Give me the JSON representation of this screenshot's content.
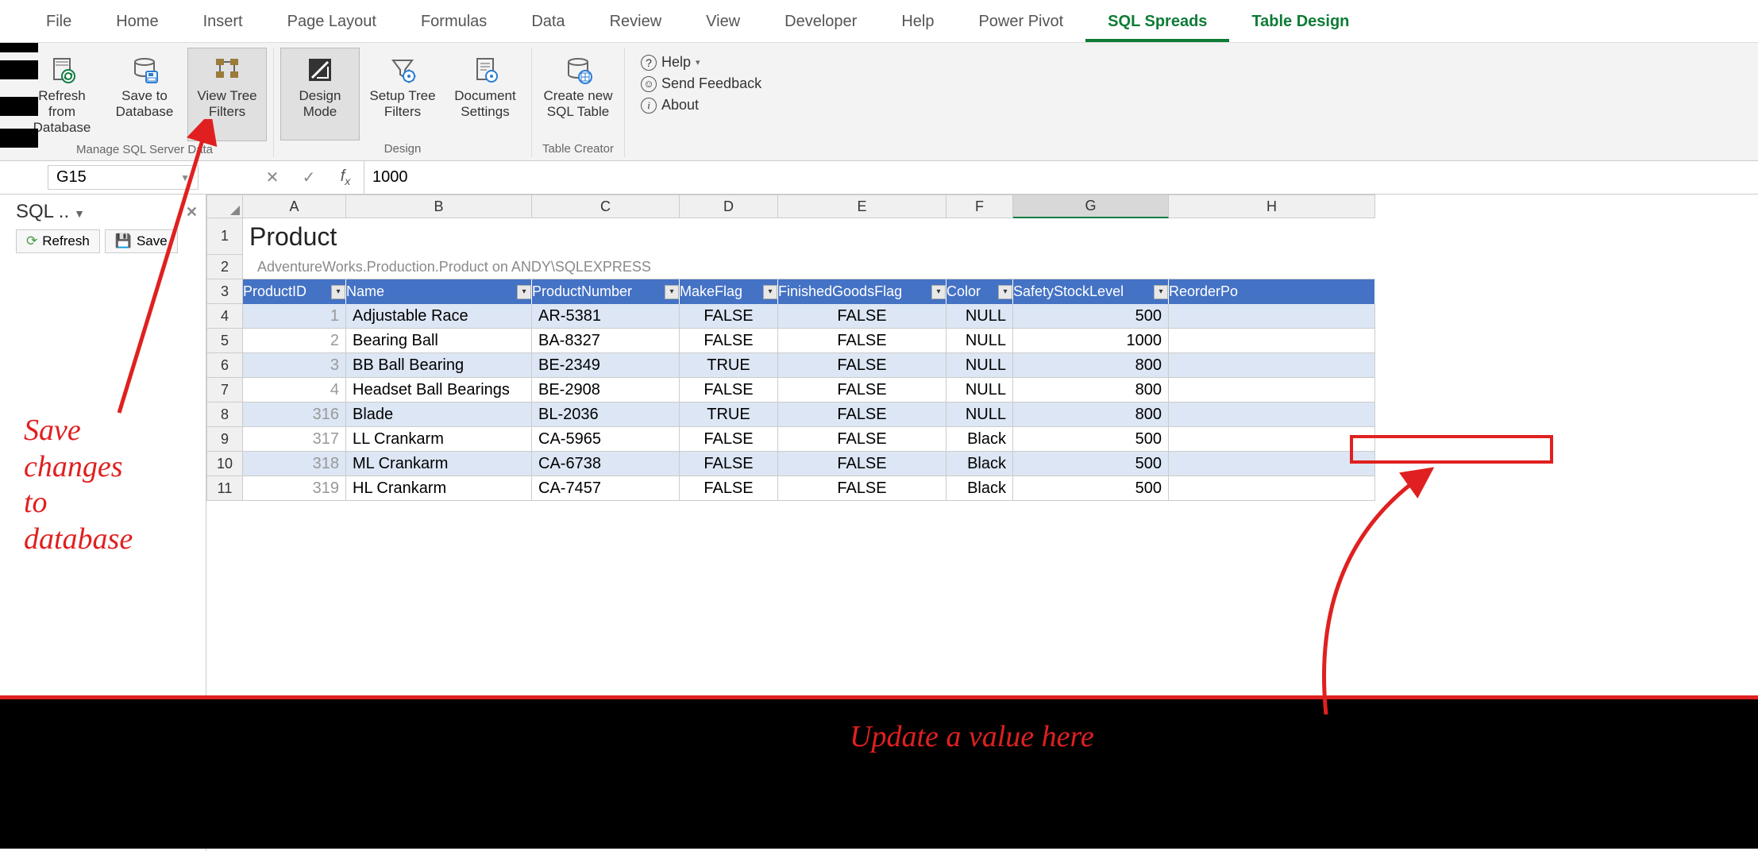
{
  "tabs": [
    "File",
    "Home",
    "Insert",
    "Page Layout",
    "Formulas",
    "Data",
    "Review",
    "View",
    "Developer",
    "Help",
    "Power Pivot",
    "SQL Spreads",
    "Table Design"
  ],
  "active_tab": "SQL Spreads",
  "context_tab": "Table Design",
  "ribbon": {
    "groups": [
      {
        "label": "Manage SQL Server Data",
        "buttons": [
          {
            "label": "Refresh from Database",
            "icon": "refresh-db"
          },
          {
            "label": "Save to Database",
            "icon": "save-db"
          },
          {
            "label": "View Tree Filters",
            "icon": "tree-filters",
            "dark": true
          }
        ]
      },
      {
        "label": "Design",
        "buttons": [
          {
            "label": "Design Mode",
            "icon": "design-mode",
            "dark": true
          },
          {
            "label": "Setup Tree Filters",
            "icon": "setup-filters"
          },
          {
            "label": "Document Settings",
            "icon": "doc-settings"
          }
        ]
      },
      {
        "label": "Table Creator",
        "buttons": [
          {
            "label": "Create new SQL Table",
            "icon": "create-table"
          }
        ]
      }
    ],
    "help": {
      "help": "Help",
      "feedback": "Send Feedback",
      "about": "About"
    }
  },
  "namebox": "G15",
  "formula": "1000",
  "side": {
    "title": "SQL ..",
    "refresh": "Refresh",
    "save": "Save"
  },
  "sheet": {
    "title": "Product",
    "subtitle": "AdventureWorks.Production.Product on ANDY\\SQLEXPRESS",
    "columns": [
      "A",
      "B",
      "C",
      "D",
      "E",
      "F",
      "G",
      "H"
    ],
    "headers": [
      "ProductID",
      "Name",
      "ProductNumber",
      "MakeFlag",
      "FinishedGoodsFlag",
      "Color",
      "SafetyStockLevel",
      "ReorderPoint"
    ],
    "header_display_last": "ReorderPo",
    "rows": [
      {
        "n": 4,
        "pid": "1",
        "name": "Adjustable Race",
        "pnum": "AR-5381",
        "make": "FALSE",
        "fin": "FALSE",
        "color": "NULL",
        "ssl": "500"
      },
      {
        "n": 5,
        "pid": "2",
        "name": "Bearing Ball",
        "pnum": "BA-8327",
        "make": "FALSE",
        "fin": "FALSE",
        "color": "NULL",
        "ssl": "1000"
      },
      {
        "n": 6,
        "pid": "3",
        "name": "BB Ball Bearing",
        "pnum": "BE-2349",
        "make": "TRUE",
        "fin": "FALSE",
        "color": "NULL",
        "ssl": "800"
      },
      {
        "n": 7,
        "pid": "4",
        "name": "Headset Ball Bearings",
        "pnum": "BE-2908",
        "make": "FALSE",
        "fin": "FALSE",
        "color": "NULL",
        "ssl": "800"
      },
      {
        "n": 8,
        "pid": "316",
        "name": "Blade",
        "pnum": "BL-2036",
        "make": "TRUE",
        "fin": "FALSE",
        "color": "NULL",
        "ssl": "800"
      },
      {
        "n": 9,
        "pid": "317",
        "name": "LL Crankarm",
        "pnum": "CA-5965",
        "make": "FALSE",
        "fin": "FALSE",
        "color": "Black",
        "ssl": "500"
      },
      {
        "n": 10,
        "pid": "318",
        "name": "ML Crankarm",
        "pnum": "CA-6738",
        "make": "FALSE",
        "fin": "FALSE",
        "color": "Black",
        "ssl": "500"
      },
      {
        "n": 11,
        "pid": "319",
        "name": "HL Crankarm",
        "pnum": "CA-7457",
        "make": "FALSE",
        "fin": "FALSE",
        "color": "Black",
        "ssl": "500"
      }
    ]
  },
  "annotations": {
    "left": "Save\nchanges\nto\ndatabase",
    "bottom": "Update a value here"
  }
}
